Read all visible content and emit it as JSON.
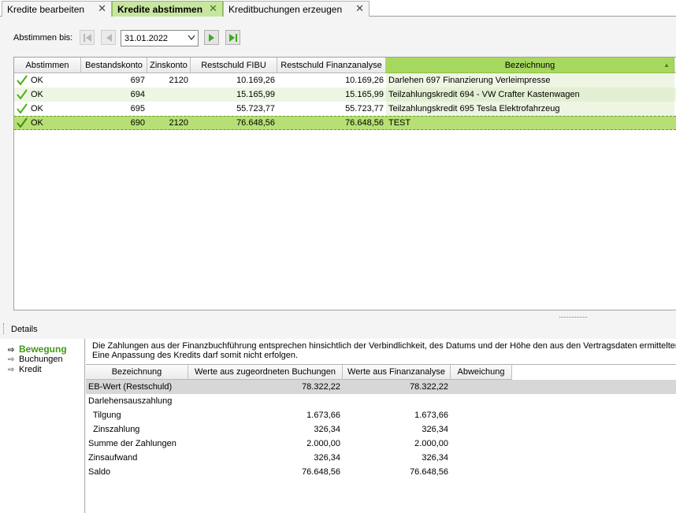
{
  "tabs": [
    {
      "label": "Kredite bearbeiten",
      "close": "✕"
    },
    {
      "label": "Kredite abstimmen",
      "close": "✕",
      "active": true
    },
    {
      "label": "Kreditbuchungen erzeugen",
      "close": "✕"
    }
  ],
  "toolbar": {
    "label": "Abstimmen bis:",
    "date": "31.01.2022"
  },
  "grid": {
    "columns": [
      "Abstimmen",
      "Bestandskonto",
      "Zinskonto",
      "Restschuld FIBU",
      "Restschuld Finanzanalyse",
      "Bezeichnung"
    ],
    "sorted_column": "Bezeichnung",
    "rows": [
      {
        "status": "OK",
        "bestandskonto": "697",
        "zinskonto": "2120",
        "restschuld_fibu": "10.169,26",
        "restschuld_fa": "10.169,26",
        "bezeichnung": "Darlehen 697 Finanzierung Verleimpresse"
      },
      {
        "status": "OK",
        "bestandskonto": "694",
        "zinskonto": "",
        "restschuld_fibu": "15.165,99",
        "restschuld_fa": "15.165,99",
        "bezeichnung": "Teilzahlungskredit 694 - VW Crafter Kastenwagen"
      },
      {
        "status": "OK",
        "bestandskonto": "695",
        "zinskonto": "",
        "restschuld_fibu": "55.723,77",
        "restschuld_fa": "55.723,77",
        "bezeichnung": "Teilzahlungskredit 695 Tesla Elektrofahrzeug"
      },
      {
        "status": "OK",
        "bestandskonto": "690",
        "zinskonto": "2120",
        "restschuld_fibu": "76.648,56",
        "restschuld_fa": "76.648,56",
        "bezeichnung": "TEST"
      }
    ],
    "selected_row": 3
  },
  "details": {
    "title": "Details",
    "nav": [
      "Bewegung",
      "Buchungen",
      "Kredit"
    ],
    "active_nav": "Bewegung",
    "info_line1": "Die Zahlungen aus der Finanzbuchführung entsprechen hinsichtlich der Verbindlichkeit, des Datums und der Höhe den aus den Vertragsdaten ermittelten Zahlu",
    "info_line2": "Eine Anpassung des Kredits darf somit nicht erfolgen.",
    "columns": [
      "Bezeichnung",
      "Werte aus zugeordneten Buchungen",
      "Werte aus Finanzanalyse",
      "Abweichung"
    ],
    "rows": [
      {
        "label": "EB-Wert (Restschuld)",
        "buchungen": "78.322,22",
        "finanzanalyse": "78.322,22",
        "abweichung": "",
        "highlight": true
      },
      {
        "label": "Darlehensauszahlung",
        "buchungen": "",
        "finanzanalyse": "",
        "abweichung": ""
      },
      {
        "label": "  Tilgung",
        "buchungen": "1.673,66",
        "finanzanalyse": "1.673,66",
        "abweichung": ""
      },
      {
        "label": "  Zinszahlung",
        "buchungen": "326,34",
        "finanzanalyse": "326,34",
        "abweichung": ""
      },
      {
        "label": "Summe der Zahlungen",
        "buchungen": "2.000,00",
        "finanzanalyse": "2.000,00",
        "abweichung": ""
      },
      {
        "label": "Zinsaufwand",
        "buchungen": "326,34",
        "finanzanalyse": "326,34",
        "abweichung": ""
      },
      {
        "label": "Saldo",
        "buchungen": "76.648,56",
        "finanzanalyse": "76.648,56",
        "abweichung": ""
      }
    ]
  },
  "colors": {
    "accent": "#a6d85f",
    "selected_row": "#b6e075",
    "active_tab": "#c8e6a0",
    "nav_active": "#3f9a14",
    "check": "#4caf1a"
  },
  "icons": {
    "first": "nav-first-icon",
    "prev": "nav-prev-icon",
    "next": "nav-next-icon",
    "last": "nav-last-icon",
    "ok": "checkmark-icon",
    "nav_arrow": "arrow-right-icon"
  }
}
